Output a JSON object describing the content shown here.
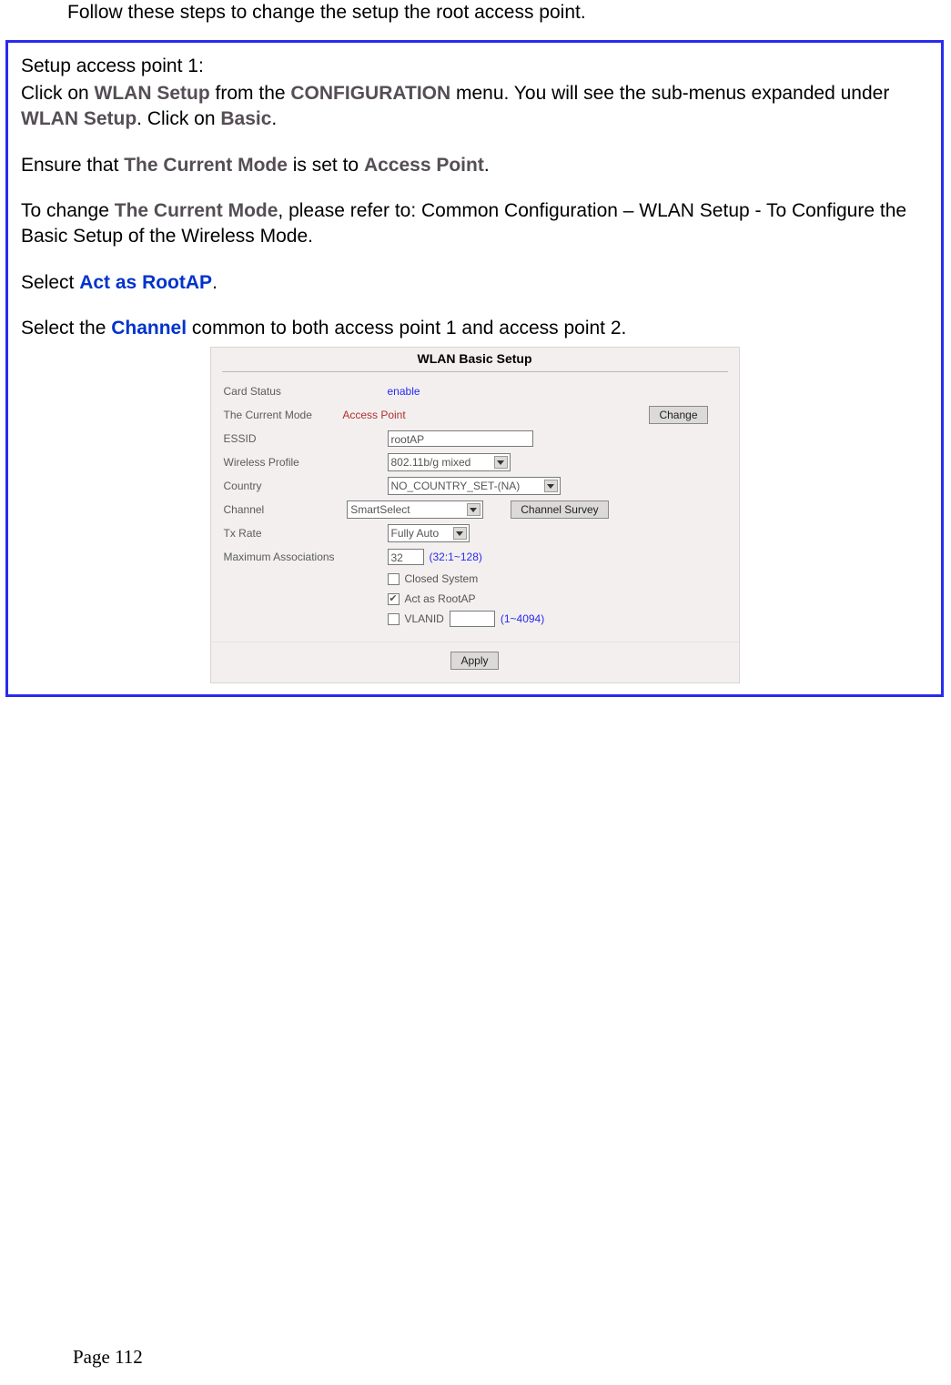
{
  "intro": "Follow these steps to change the setup the root access point.",
  "step_title": "Setup access point 1:",
  "p1": {
    "a": "Click on ",
    "wlan_setup": "WLAN Setup",
    "b": " from the ",
    "config": "CONFIGURATION",
    "c": " menu. You will see the sub-menus expanded under ",
    "wlan_setup2": "WLAN Setup",
    "d": ". Click on ",
    "basic": "Basic",
    "e": "."
  },
  "p2": {
    "a": "Ensure that ",
    "cur_mode": "The Current Mode",
    "b": " is set to ",
    "ap": "Access Point",
    "c": "."
  },
  "p3": {
    "a": "To change ",
    "cur_mode": "The Current Mode",
    "b": ", please refer to: Common Configuration – WLAN Setup - To Configure the Basic Setup of the Wireless Mode."
  },
  "p4": {
    "a": "Select ",
    "act": "Act as RootAP",
    "b": "."
  },
  "p5": {
    "a": "Select the ",
    "channel": "Channel",
    "b": " common to both access point 1 and access point 2."
  },
  "panel": {
    "title": "WLAN Basic Setup",
    "rows": {
      "card_status": {
        "label": "Card Status",
        "value": "enable"
      },
      "current_mode": {
        "label": "The Current Mode",
        "value": "Access Point",
        "change_btn": "Change"
      },
      "essid": {
        "label": "ESSID",
        "value": "rootAP"
      },
      "wireless_profile": {
        "label": "Wireless Profile",
        "value": "802.11b/g mixed"
      },
      "country": {
        "label": "Country",
        "value": "NO_COUNTRY_SET-(NA)"
      },
      "channel": {
        "label": "Channel",
        "value": "SmartSelect",
        "survey_btn": "Channel Survey"
      },
      "tx_rate": {
        "label": "Tx Rate",
        "value": "Fully Auto"
      },
      "max_assoc": {
        "label": "Maximum Associations",
        "value": "32",
        "hint": "(32:1~128)"
      }
    },
    "checks": {
      "closed_system": {
        "label": "Closed System",
        "checked": false
      },
      "act_root": {
        "label": "Act as RootAP",
        "checked": true
      },
      "vlanid": {
        "label": "VLANID",
        "checked": false,
        "value": "",
        "hint": "(1~4094)"
      }
    },
    "apply": "Apply"
  },
  "page_number": "Page 112"
}
